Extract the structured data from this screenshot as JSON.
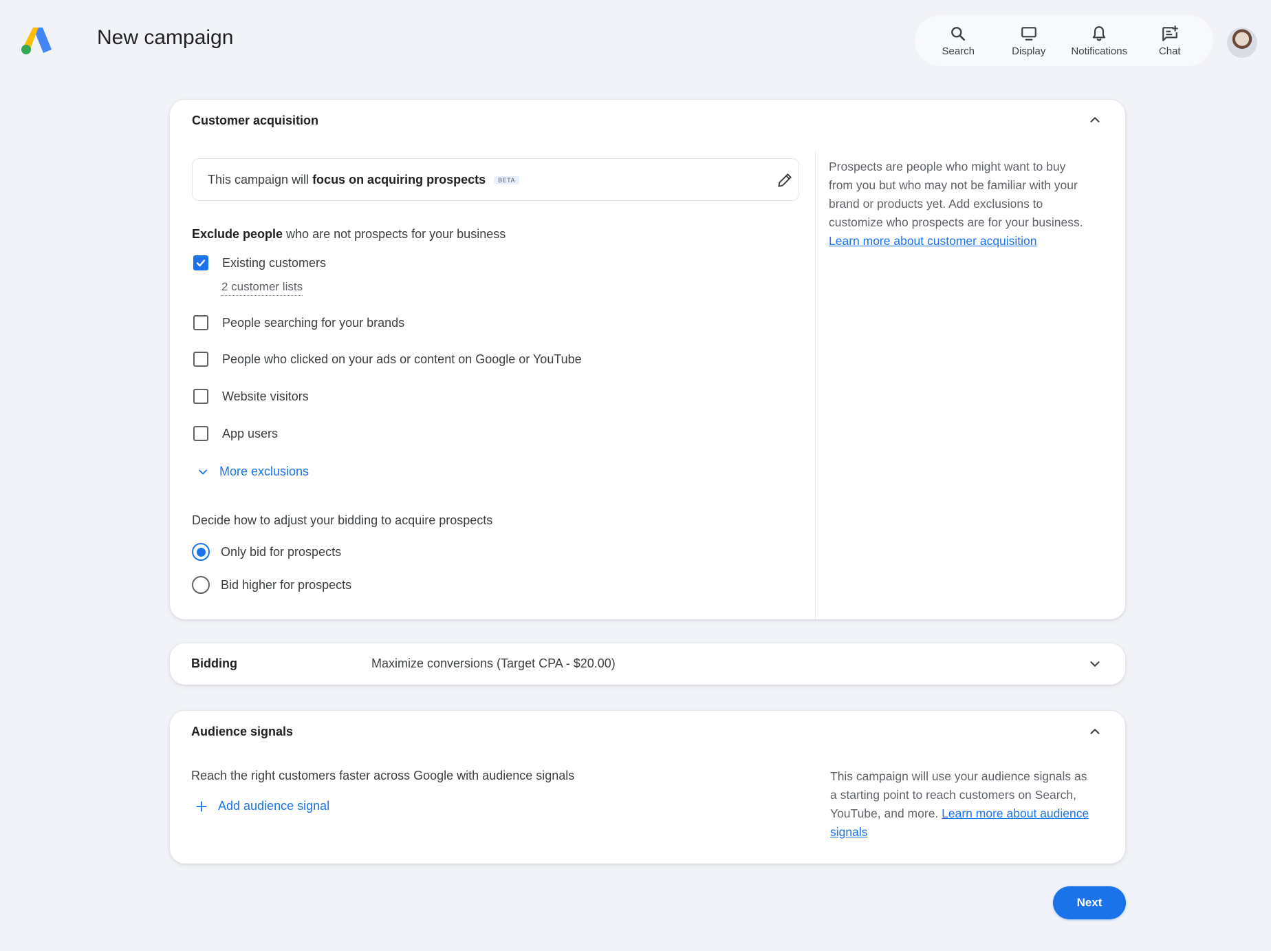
{
  "header": {
    "title": "New campaign",
    "logo": "google-ads-logo",
    "tools": [
      {
        "label": "Search",
        "icon": "search-icon"
      },
      {
        "label": "Display",
        "icon": "display-icon"
      },
      {
        "label": "Notifications",
        "icon": "bell-icon"
      },
      {
        "label": "Chat",
        "icon": "chat-icon"
      }
    ]
  },
  "acquisition": {
    "title": "Customer acquisition",
    "focus_prefix": "This campaign will ",
    "focus_bold": "focus on acquiring prospects",
    "badge": "BETA",
    "exclude_bold": "Exclude people",
    "exclude_rest": " who are not prospects for your business",
    "exclusions": [
      {
        "label": "Existing customers",
        "checked": true
      },
      {
        "label": "People searching for your brands",
        "checked": false
      },
      {
        "label": "People who clicked on your ads or content on Google or YouTube",
        "checked": false
      },
      {
        "label": "Website visitors",
        "checked": false
      },
      {
        "label": "App users",
        "checked": false
      }
    ],
    "customer_lists": "2 customer lists",
    "more_exclusions": "More exclusions",
    "bid_heading": "Decide how to adjust your bidding to acquire prospects",
    "bid_options": [
      {
        "label": "Only bid for prospects",
        "selected": true
      },
      {
        "label": "Bid higher for prospects",
        "selected": false
      }
    ],
    "side_text": "Prospects are people who might want to buy from you but who may not be familiar with your brand or products yet. Add exclusions to customize who prospects are for your business. ",
    "side_link": "Learn more about customer acquisition"
  },
  "bidding": {
    "label": "Bidding",
    "value": "Maximize conversions (Target CPA - $20.00)"
  },
  "audience": {
    "title": "Audience signals",
    "description": "Reach the right customers faster across Google with audience signals",
    "add_label": "Add audience signal",
    "side_text": "This campaign will use your audience signals as a starting point to reach customers on Search, YouTube, and more. ",
    "side_link": "Learn more about audience signals"
  },
  "footer": {
    "next_label": "Next"
  },
  "colors": {
    "accent": "#1a73e8",
    "background": "#f1f3f8"
  }
}
